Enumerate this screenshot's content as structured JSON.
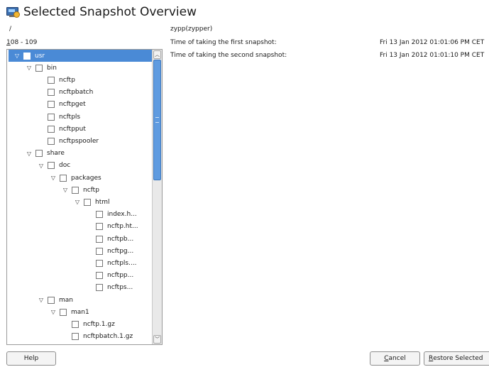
{
  "title": "Selected Snapshot Overview",
  "path": "/",
  "range": {
    "first_char": "1",
    "rest": "08 - 109"
  },
  "info": {
    "description": "zypp(zypper)",
    "first_label": "Time of taking the first snapshot:",
    "first_value": "Fri 13 Jan 2012 01:01:06 PM CET",
    "second_label": "Time of taking the second snapshot:",
    "second_value": "Fri 13 Jan 2012 01:01:10 PM CET"
  },
  "tree": [
    {
      "label": "usr",
      "indent": 0,
      "expanded": true,
      "selected": true
    },
    {
      "label": "bin",
      "indent": 1,
      "expanded": true
    },
    {
      "label": "ncftp",
      "indent": 2
    },
    {
      "label": "ncftpbatch",
      "indent": 2
    },
    {
      "label": "ncftpget",
      "indent": 2
    },
    {
      "label": "ncftpls",
      "indent": 2
    },
    {
      "label": "ncftpput",
      "indent": 2
    },
    {
      "label": "ncftpspooler",
      "indent": 2
    },
    {
      "label": "share",
      "indent": 1,
      "expanded": true
    },
    {
      "label": "doc",
      "indent": 2,
      "expanded": true
    },
    {
      "label": "packages",
      "indent": 3,
      "expanded": true
    },
    {
      "label": "ncftp",
      "indent": 4,
      "expanded": true
    },
    {
      "label": "html",
      "indent": 5,
      "expanded": true
    },
    {
      "label": "index.h...",
      "indent": 6
    },
    {
      "label": "ncftp.ht...",
      "indent": 6
    },
    {
      "label": "ncftpb...",
      "indent": 6
    },
    {
      "label": "ncftpg...",
      "indent": 6
    },
    {
      "label": "ncftpls....",
      "indent": 6
    },
    {
      "label": "ncftpp...",
      "indent": 6
    },
    {
      "label": "ncftps...",
      "indent": 6
    },
    {
      "label": "man",
      "indent": 2,
      "expanded": true
    },
    {
      "label": "man1",
      "indent": 3,
      "expanded": true
    },
    {
      "label": "ncftp.1.gz",
      "indent": 4
    },
    {
      "label": "ncftpbatch.1.gz",
      "indent": 4
    }
  ],
  "buttons": {
    "help": "Help",
    "cancel_first": "C",
    "cancel_rest": "ancel",
    "restore_first": "R",
    "restore_rest": "estore Selected"
  }
}
